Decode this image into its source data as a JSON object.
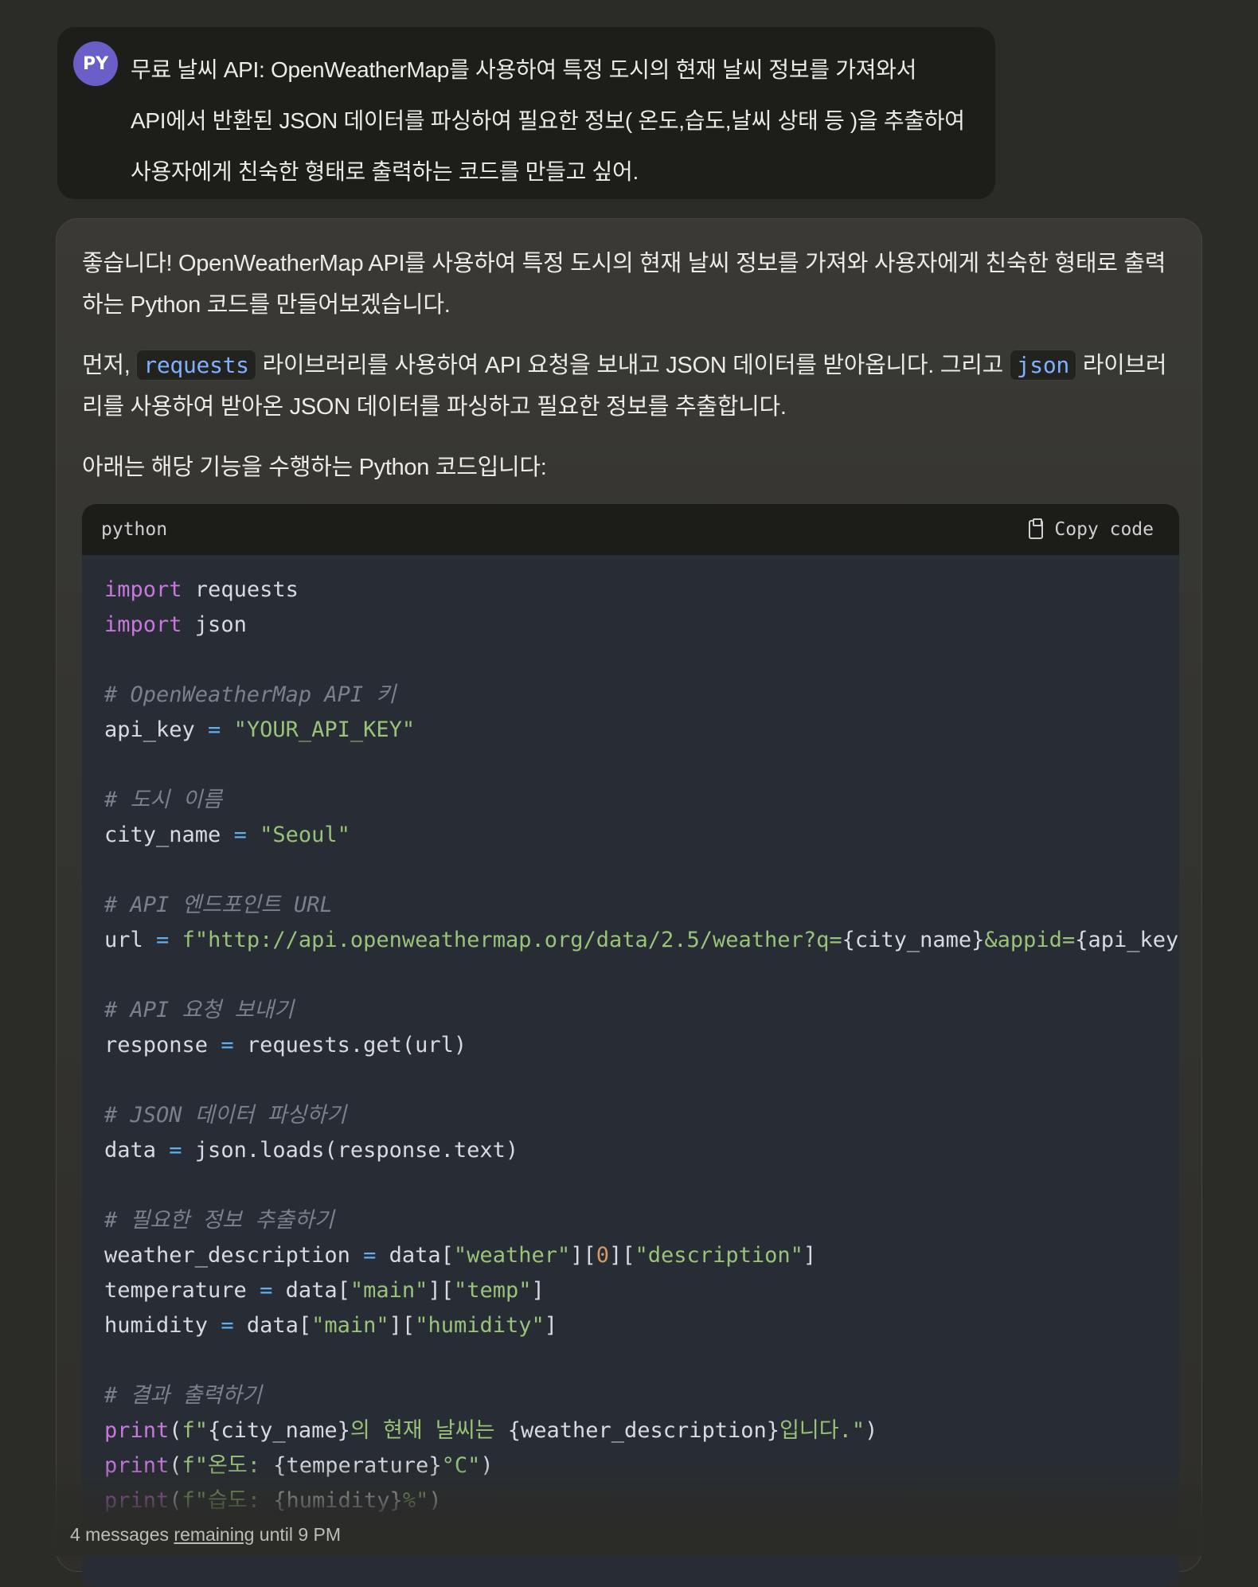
{
  "user": {
    "avatar_initials": "PY",
    "lines": [
      "무료 날씨 API: OpenWeatherMap를 사용하여 특정 도시의 현재 날씨 정보를 가져와서",
      "API에서 반환된 JSON 데이터를 파싱하여 필요한 정보( 온도,습도,날씨 상태 등 )을 추출하여",
      "사용자에게 친숙한 형태로 출력하는 코드를 만들고 싶어."
    ]
  },
  "assistant": {
    "p1": "좋습니다! OpenWeatherMap API를 사용하여 특정 도시의 현재 날씨 정보를 가져와 사용자에게 친숙한 형태로 출력하는 Python 코드를 만들어보겠습니다.",
    "p2_prefix": "먼저, ",
    "p2_code1": "requests",
    "p2_mid": " 라이브러리를 사용하여 API 요청을 보내고 JSON 데이터를 받아옵니다. 그리고 ",
    "p2_code2": "json",
    "p2_suffix": " 라이브러리를 사용하여 받아온 JSON 데이터를 파싱하고 필요한 정보를 추출합니다.",
    "p3": "아래는 해당 기능을 수행하는 Python 코드입니다:",
    "code_language": "python",
    "copy_label": "Copy code",
    "code_lines": [
      [
        {
          "t": "import",
          "c": "kw"
        },
        {
          "t": " requests"
        }
      ],
      [
        {
          "t": "import",
          "c": "kw"
        },
        {
          "t": " json"
        }
      ],
      [],
      [
        {
          "t": "# OpenWeatherMap API 키",
          "c": "cm"
        }
      ],
      [
        {
          "t": "api_key "
        },
        {
          "t": "=",
          "c": "op"
        },
        {
          "t": " "
        },
        {
          "t": "\"YOUR_API_KEY\"",
          "c": "str"
        }
      ],
      [],
      [
        {
          "t": "# 도시 이름",
          "c": "cm"
        }
      ],
      [
        {
          "t": "city_name "
        },
        {
          "t": "=",
          "c": "op"
        },
        {
          "t": " "
        },
        {
          "t": "\"Seoul\"",
          "c": "str"
        }
      ],
      [],
      [
        {
          "t": "# API 엔드포인트 URL",
          "c": "cm"
        }
      ],
      [
        {
          "t": "url "
        },
        {
          "t": "=",
          "c": "op"
        },
        {
          "t": " "
        },
        {
          "t": "f\"http://api.openweathermap.org/data/2.5/weather?q=",
          "c": "str"
        },
        {
          "t": "{city_name}"
        },
        {
          "t": "&appid=",
          "c": "str"
        },
        {
          "t": "{api_key}"
        }
      ],
      [],
      [
        {
          "t": "# API 요청 보내기",
          "c": "cm"
        }
      ],
      [
        {
          "t": "response "
        },
        {
          "t": "=",
          "c": "op"
        },
        {
          "t": " requests.get(url)"
        }
      ],
      [],
      [
        {
          "t": "# JSON 데이터 파싱하기",
          "c": "cm"
        }
      ],
      [
        {
          "t": "data "
        },
        {
          "t": "=",
          "c": "op"
        },
        {
          "t": " json.loads(response.text)"
        }
      ],
      [],
      [
        {
          "t": "# 필요한 정보 추출하기",
          "c": "cm"
        }
      ],
      [
        {
          "t": "weather_description "
        },
        {
          "t": "=",
          "c": "op"
        },
        {
          "t": " data["
        },
        {
          "t": "\"weather\"",
          "c": "str"
        },
        {
          "t": "]["
        },
        {
          "t": "0",
          "c": "num"
        },
        {
          "t": "]["
        },
        {
          "t": "\"description\"",
          "c": "str"
        },
        {
          "t": "]"
        }
      ],
      [
        {
          "t": "temperature "
        },
        {
          "t": "=",
          "c": "op"
        },
        {
          "t": " data["
        },
        {
          "t": "\"main\"",
          "c": "str"
        },
        {
          "t": "]["
        },
        {
          "t": "\"temp\"",
          "c": "str"
        },
        {
          "t": "]"
        }
      ],
      [
        {
          "t": "humidity "
        },
        {
          "t": "=",
          "c": "op"
        },
        {
          "t": " data["
        },
        {
          "t": "\"main\"",
          "c": "str"
        },
        {
          "t": "]["
        },
        {
          "t": "\"humidity\"",
          "c": "str"
        },
        {
          "t": "]"
        }
      ],
      [],
      [
        {
          "t": "# 결과 출력하기",
          "c": "cm"
        }
      ],
      [
        {
          "t": "print",
          "c": "fn"
        },
        {
          "t": "("
        },
        {
          "t": "f\"",
          "c": "str"
        },
        {
          "t": "{city_name}"
        },
        {
          "t": "의 현재 날씨는 ",
          "c": "str"
        },
        {
          "t": "{weather_description}"
        },
        {
          "t": "입니다.\"",
          "c": "str"
        },
        {
          "t": ")"
        }
      ],
      [
        {
          "t": "print",
          "c": "fn"
        },
        {
          "t": "("
        },
        {
          "t": "f\"온도: ",
          "c": "str"
        },
        {
          "t": "{temperature}"
        },
        {
          "t": "°C\"",
          "c": "str"
        },
        {
          "t": ")"
        }
      ],
      [
        {
          "t": "print",
          "c": "fn"
        },
        {
          "t": "("
        },
        {
          "t": "f\"습도: ",
          "c": "str"
        },
        {
          "t": "{humidity}"
        },
        {
          "t": "%\"",
          "c": "str"
        },
        {
          "t": ")"
        }
      ]
    ]
  },
  "footer": {
    "prefix": "4 messages ",
    "link": "remaining",
    "suffix": " until 9 PM"
  }
}
